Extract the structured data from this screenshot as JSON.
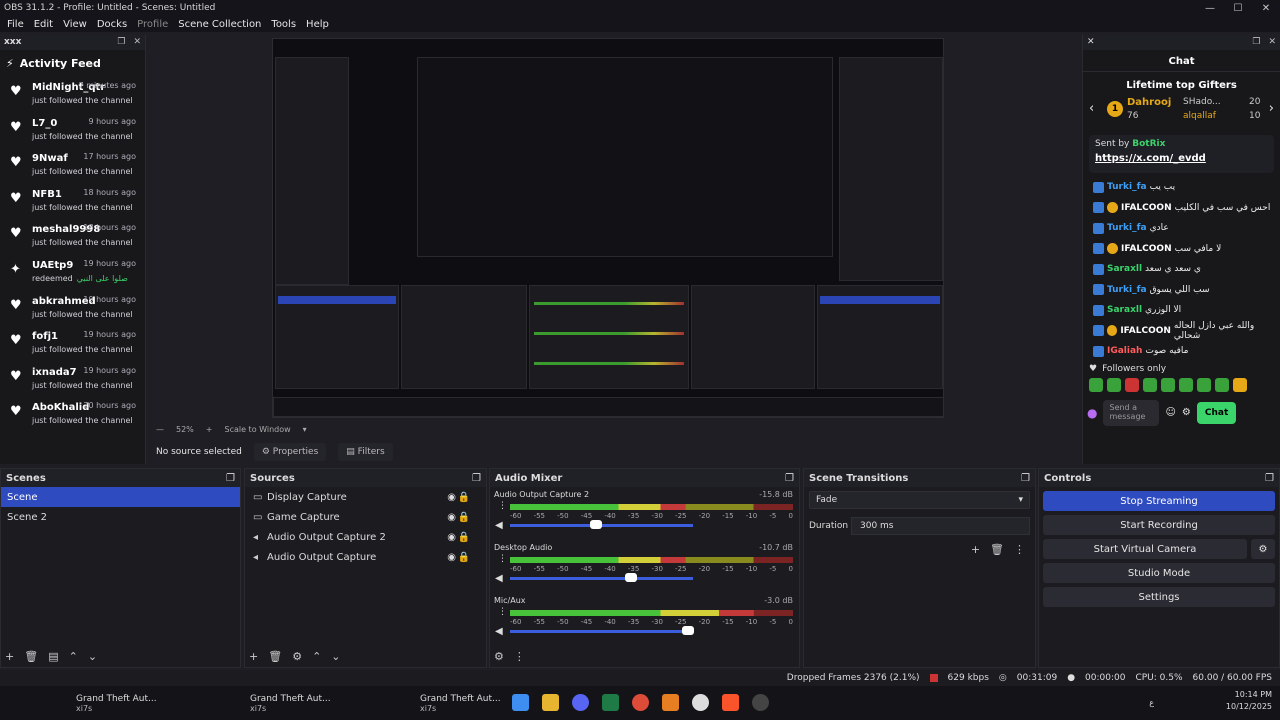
{
  "app": {
    "title": "OBS 31.1.2 - Profile: Untitled - Scenes: Untitled",
    "menu": [
      "File",
      "Edit",
      "View",
      "Docks",
      "Profile",
      "Scene Collection",
      "Tools",
      "Help"
    ]
  },
  "activity_dock": {
    "header": "xxx",
    "title": "Activity Feed",
    "items": [
      {
        "name": "MidNight_qtr",
        "time": "7 minutes ago",
        "desc": "just followed the channel",
        "extra": ""
      },
      {
        "name": "L7_0",
        "time": "9 hours ago",
        "desc": "just followed the channel",
        "extra": ""
      },
      {
        "name": "9Nwaf",
        "time": "17 hours ago",
        "desc": "just followed the channel",
        "extra": ""
      },
      {
        "name": "NFB1",
        "time": "18 hours ago",
        "desc": "just followed the channel",
        "extra": ""
      },
      {
        "name": "meshal9998",
        "time": "18 hours ago",
        "desc": "just followed the channel",
        "extra": ""
      },
      {
        "name": "UAEtp9",
        "time": "19 hours ago",
        "desc": "redeemed",
        "extra": "صلوا على النبي"
      },
      {
        "name": "abkrahmed",
        "time": "19 hours ago",
        "desc": "just followed the channel",
        "extra": ""
      },
      {
        "name": "fofj1",
        "time": "19 hours ago",
        "desc": "just followed the channel",
        "extra": ""
      },
      {
        "name": "ixnada7",
        "time": "19 hours ago",
        "desc": "just followed the channel",
        "extra": ""
      },
      {
        "name": "AboKhalid",
        "time": "20 hours ago",
        "desc": "just followed the channel",
        "extra": ""
      }
    ]
  },
  "preview": {
    "zoom": "52%",
    "scale_mode": "Scale to Window",
    "status": "No source selected",
    "properties_btn": "Properties",
    "filters_btn": "Filters"
  },
  "chat_dock": {
    "title": "Chat",
    "gifters_title": "Lifetime top Gifters",
    "gifters": [
      {
        "rank": "1",
        "name": "Dahrooj",
        "count": "76"
      },
      {
        "name": "SHado...",
        "count": "20"
      },
      {
        "name": "alqallaf",
        "count": "10"
      }
    ],
    "pinned_sender_label": "Sent by",
    "pinned_bot": "BotRix",
    "pinned_link": "https://x.com/_evdd",
    "messages": [
      {
        "user": "Turki_fa",
        "color": "#3d9ff5",
        "text": "يب يب",
        "gold": false
      },
      {
        "user": "IFALCOON",
        "color": "#ffffff",
        "text": "احس في سب في الكليب",
        "gold": true
      },
      {
        "user": "Turki_fa",
        "color": "#3d9ff5",
        "text": "عادي",
        "gold": false
      },
      {
        "user": "IFALCOON",
        "color": "#ffffff",
        "text": "لا مافي سب",
        "gold": true
      },
      {
        "user": "Saraxll",
        "color": "#3ad46a",
        "text": "ي سعد ي سعد",
        "gold": false
      },
      {
        "user": "Turki_fa",
        "color": "#3d9ff5",
        "text": "سب اللي يسوق",
        "gold": false
      },
      {
        "user": "Saraxll",
        "color": "#3ad46a",
        "text": "الا الوزري",
        "gold": false
      },
      {
        "user": "IFALCOON",
        "color": "#ffffff",
        "text": "والله عبي دازل الحاله شحالي",
        "gold": true
      },
      {
        "user": "IGaliah",
        "color": "#ff5c5c",
        "text": "مافيه صوت",
        "gold": false
      }
    ],
    "followers_only": "Followers only",
    "input_placeholder": "Send a message",
    "send_btn": "Chat"
  },
  "scenes": {
    "title": "Scenes",
    "items": [
      "Scene",
      "Scene 2"
    ]
  },
  "sources": {
    "title": "Sources",
    "items": [
      {
        "name": "Display Capture",
        "icon": "monitor-icon"
      },
      {
        "name": "Game Capture",
        "icon": "gamepad-icon"
      },
      {
        "name": "Audio Output Capture 2",
        "icon": "speaker-icon"
      },
      {
        "name": "Audio Output Capture",
        "icon": "speaker-icon"
      }
    ]
  },
  "mixer": {
    "title": "Audio Mixer",
    "scale": [
      "-60",
      "-55",
      "-50",
      "-45",
      "-40",
      "-35",
      "-30",
      "-25",
      "-20",
      "-15",
      "-10",
      "-5",
      "0"
    ],
    "channels": [
      {
        "name": "Audio Output Capture 2",
        "db": "-15.8 dB",
        "level": 0.62,
        "fader": 0.47
      },
      {
        "name": "Desktop Audio",
        "db": "-10.7 dB",
        "level": 0.62,
        "fader": 0.66
      },
      {
        "name": "Mic/Aux",
        "db": "-3.0 dB",
        "level": 0.86,
        "fader": 0.97
      }
    ]
  },
  "transitions": {
    "title": "Scene Transitions",
    "selected": "Fade",
    "duration_label": "Duration",
    "duration_value": "300 ms"
  },
  "controls": {
    "title": "Controls",
    "buttons": [
      "Stop Streaming",
      "Start Recording",
      "Start Virtual Camera",
      "Studio Mode",
      "Settings"
    ]
  },
  "status": {
    "dropped": "Dropped Frames 2376 (2.1%)",
    "bitrate": "629 kbps",
    "stream_time": "00:31:09",
    "rec_time": "00:00:00",
    "cpu": "CPU: 0.5%",
    "fps": "60.00 / 60.00 FPS"
  },
  "taskbar": {
    "items": [
      {
        "title": "Grand Theft Aut...",
        "sub": "xi7s"
      },
      {
        "title": "Grand Theft Aut...",
        "sub": "xi7s"
      },
      {
        "title": "Grand Theft Aut...",
        "sub": "xi7s"
      }
    ],
    "time": "10:14 PM",
    "date": "10/12/2025",
    "lang": "ع"
  }
}
